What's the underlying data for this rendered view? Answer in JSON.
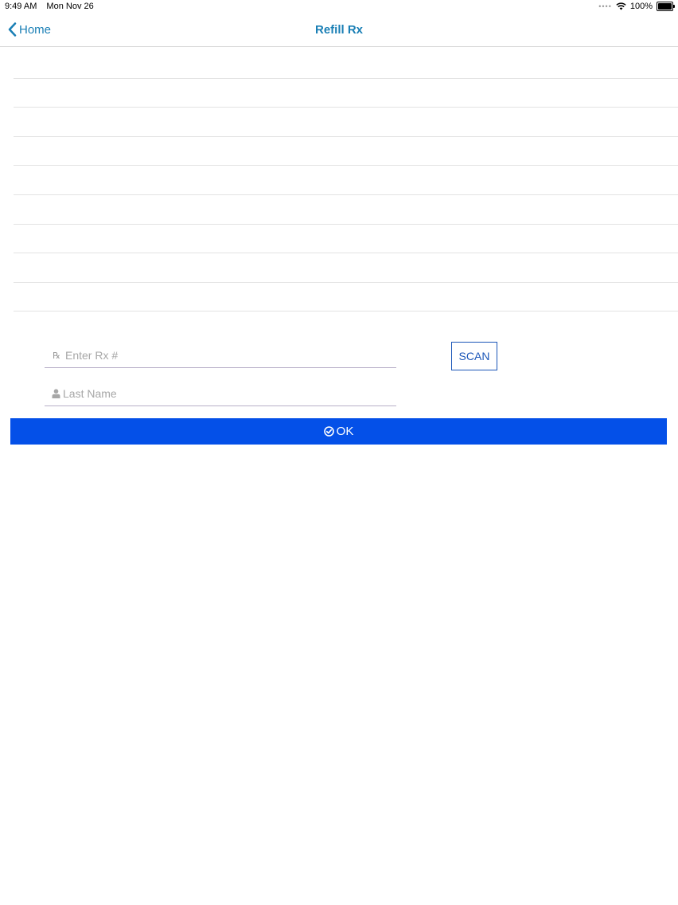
{
  "status_bar": {
    "time": "9:49 AM",
    "date": "Mon Nov 26",
    "battery": "100%"
  },
  "nav": {
    "back_label": "Home",
    "title": "Refill Rx"
  },
  "list": {
    "row_count": 9
  },
  "form": {
    "rx_placeholder": "Enter Rx #",
    "rx_icon": "prescription-icon",
    "last_name_placeholder": "Last Name",
    "last_name_icon": "user-icon",
    "scan_label": "SCAN",
    "ok_label": "OK",
    "ok_icon": "check-circle-icon"
  },
  "colors": {
    "nav_tint": "#1a7fb5",
    "primary_button": "#0450e8",
    "scan_border": "#1b56b8"
  }
}
